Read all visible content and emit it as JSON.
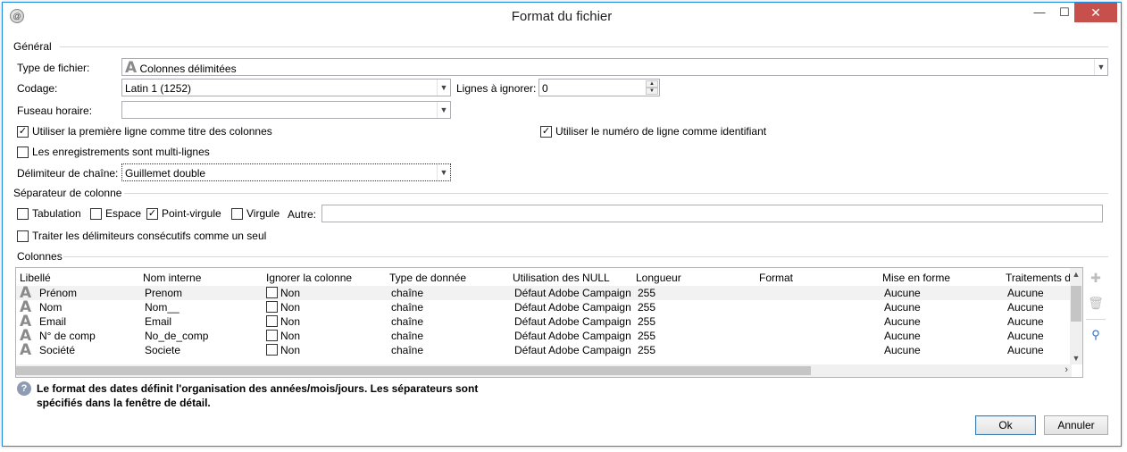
{
  "window": {
    "title": "Format du fichier",
    "controls": {
      "minimize": "—",
      "maximize": "☐",
      "close": "✕"
    }
  },
  "general": {
    "group_label": "Général",
    "file_type": {
      "label": "Type de fichier:",
      "value": "Colonnes délimitées"
    },
    "encoding": {
      "label": "Codage:",
      "value": "Latin 1 (1252)"
    },
    "lines_to_skip": {
      "label": "Lignes à ignorer:",
      "value": "0"
    },
    "timezone": {
      "label": "Fuseau horaire:",
      "value": ""
    },
    "use_first_line": {
      "label": "Utiliser la première ligne comme titre des colonnes",
      "checked": true
    },
    "use_line_number": {
      "label": "Utiliser le numéro de ligne comme identifiant",
      "checked": true
    },
    "multiline": {
      "label": "Les enregistrements sont multi-lignes",
      "checked": false
    },
    "string_delimiter": {
      "label": "Délimiteur de chaîne:",
      "value": "Guillemet double"
    }
  },
  "separator": {
    "group_label": "Séparateur de colonne",
    "tab": {
      "label": "Tabulation",
      "checked": false
    },
    "space": {
      "label": "Espace",
      "checked": false
    },
    "semicolon": {
      "label": "Point-virgule",
      "checked": true
    },
    "comma": {
      "label": "Virgule",
      "checked": false
    },
    "other_label": "Autre:",
    "other_value": "",
    "consecutive": {
      "label": "Traiter les délimiteurs consécutifs comme un seul",
      "checked": false
    }
  },
  "columns": {
    "group_label": "Colonnes",
    "headers": [
      "Libellé",
      "Nom interne",
      "Ignorer la colonne",
      "Type de donnée",
      "Utilisation des NULL",
      "Longueur",
      "Format",
      "Mise en forme",
      "Traitements d"
    ],
    "rows": [
      {
        "label": "Prénom",
        "internal": "Prenom",
        "ignore": "Non",
        "type": "chaîne",
        "null_usage": "Défaut Adobe Campaign",
        "length": "255",
        "format": "",
        "formatting": "Aucune",
        "processing": "Aucune"
      },
      {
        "label": "Nom",
        "internal": "Nom__",
        "ignore": "Non",
        "type": "chaîne",
        "null_usage": "Défaut Adobe Campaign",
        "length": "255",
        "format": "",
        "formatting": "Aucune",
        "processing": "Aucune"
      },
      {
        "label": "Email",
        "internal": "Email",
        "ignore": "Non",
        "type": "chaîne",
        "null_usage": "Défaut Adobe Campaign",
        "length": "255",
        "format": "",
        "formatting": "Aucune",
        "processing": "Aucune"
      },
      {
        "label": "N° de comp",
        "internal": "No_de_comp",
        "ignore": "Non",
        "type": "chaîne",
        "null_usage": "Défaut Adobe Campaign",
        "length": "255",
        "format": "",
        "formatting": "Aucune",
        "processing": "Aucune"
      },
      {
        "label": "Société",
        "internal": "Societe",
        "ignore": "Non",
        "type": "chaîne",
        "null_usage": "Défaut Adobe Campaign",
        "length": "255",
        "format": "",
        "formatting": "Aucune",
        "processing": "Aucune"
      }
    ]
  },
  "info": {
    "text": "Le format des dates définit l'organisation des années/mois/jours. Les séparateurs sont spécifiés dans la fenêtre de détail."
  },
  "buttons": {
    "ok": "Ok",
    "cancel": "Annuler"
  },
  "colors": {
    "accent": "#1f8fe0",
    "close": "#c7504c"
  }
}
